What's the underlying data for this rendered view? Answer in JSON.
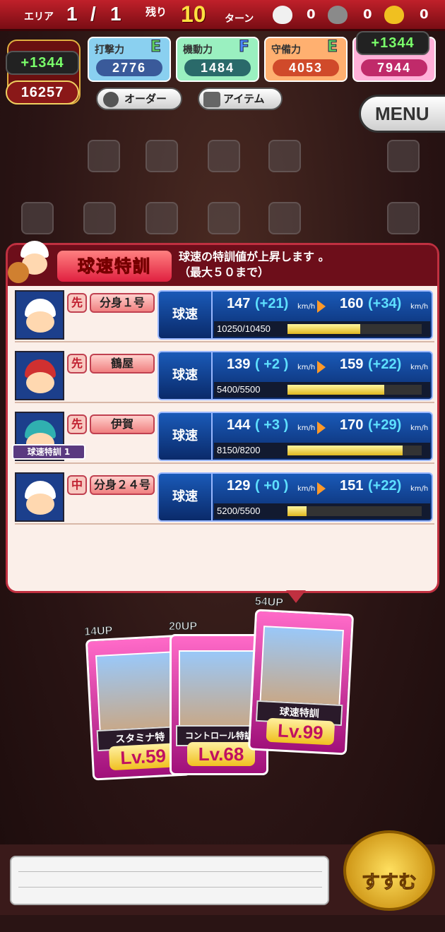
{
  "topbar": {
    "area_label": "エリア",
    "area_current": "1",
    "area_sep": "/",
    "area_total": "1",
    "remaining_label": "残り",
    "turns_value": "10",
    "turns_unit": "ターン",
    "bag_counts": [
      "0",
      "0",
      "0"
    ]
  },
  "bonus_left": "+1344",
  "bonus_right": "+1344",
  "total_value": "16257",
  "stats": [
    {
      "label": "打撃力",
      "rank": "E",
      "value": "2776",
      "color": "#8ad0f0"
    },
    {
      "label": "機動力",
      "rank": "F",
      "value": "1484",
      "color": "#9af0c0"
    },
    {
      "label": "守備力",
      "rank": "E",
      "value": "4053",
      "color": "#ffb070"
    },
    {
      "label": "",
      "rank": "",
      "value": "7944",
      "color": "#ffb0d8"
    }
  ],
  "buttons": {
    "order": "オーダー",
    "item": "アイテム",
    "menu": "MENU"
  },
  "panel": {
    "title": "球速特訓",
    "desc_line1": "球速の特訓値が上昇します 。",
    "desc_line2": "（最大５０まで）"
  },
  "rows": [
    {
      "pos": "先",
      "name": "分身１号",
      "stat": "球速",
      "cur": "147",
      "cur_delta": "(+21)",
      "unit1": "km/h",
      "next": "160",
      "next_delta": "(+34)",
      "unit2": "km/h",
      "progress_text": "10250/10450",
      "fill": 0.54,
      "tag": ""
    },
    {
      "pos": "先",
      "name": "鶴屋",
      "stat": "球速",
      "cur": "139",
      "cur_delta": "( +2 )",
      "unit1": "km/h",
      "next": "159",
      "next_delta": "(+22)",
      "unit2": "km/h",
      "progress_text": "5400/5500",
      "fill": 0.72,
      "tag": ""
    },
    {
      "pos": "先",
      "name": "伊賀",
      "stat": "球速",
      "cur": "144",
      "cur_delta": "( +3 )",
      "unit1": "km/h",
      "next": "170",
      "next_delta": "(+29)",
      "unit2": "km/h",
      "progress_text": "8150/8200",
      "fill": 0.86,
      "tag": "球速特訓 1"
    },
    {
      "pos": "中",
      "name": "分身２４号",
      "stat": "球速",
      "cur": "129",
      "cur_delta": "( +0 )",
      "unit1": "km/h",
      "next": "151",
      "next_delta": "(+22)",
      "unit2": "km/h",
      "progress_text": "5200/5500",
      "fill": 0.14,
      "tag": ""
    }
  ],
  "cards": [
    {
      "up": "14UP",
      "name": "スタミナ特",
      "lv": "Lv.59"
    },
    {
      "up": "20UP",
      "name": "コントロール特訓",
      "lv": "Lv.68"
    },
    {
      "up": "54UP",
      "name": "球速特訓",
      "lv": "Lv.99"
    }
  ],
  "go_button": "すすむ"
}
